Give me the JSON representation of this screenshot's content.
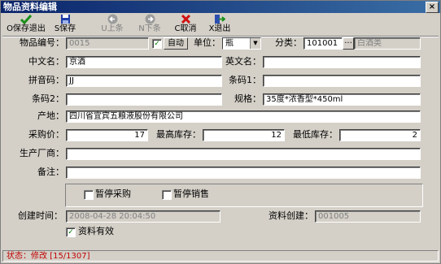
{
  "window": {
    "title": "物品资料编辑",
    "close_glyph": "×"
  },
  "toolbar": {
    "save_exit": "O保存退出",
    "save": "S保存",
    "prev": "U上条",
    "next": "N下条",
    "cancel": "C取消",
    "exit": "X退出"
  },
  "form": {
    "item_code_label": "物品编号：",
    "item_code_value": "0015",
    "auto_label": "自动",
    "unit_label": "单位：",
    "unit_value": "瓶",
    "category_label": "分类：",
    "category_code": "101001",
    "category_more": "···",
    "category_name": "白酒类",
    "cn_name_label": "中文名：",
    "cn_name_value": "京酒",
    "en_name_label": "英文名：",
    "en_name_value": "",
    "pinyin_label": "拼音码：",
    "pinyin_value": "JJ",
    "barcode1_label": "条码1：",
    "barcode1_value": "",
    "barcode2_label": "条码2：",
    "barcode2_value": "",
    "spec_label": "规格：",
    "spec_value": "35度*浓香型*450ml",
    "origin_label": "产地：",
    "origin_value": "四川省宜宾五粮液股份有限公司",
    "purchase_price_label": "采购价：",
    "purchase_price_value": "17",
    "max_stock_label": "最高库存：",
    "max_stock_value": "12",
    "min_stock_label": "最低库存：",
    "min_stock_value": "2",
    "manufacturer_label": "生产厂商：",
    "manufacturer_value": "",
    "remark_label": "备注：",
    "remark_value": "",
    "stop_purchase_label": "暂停采购",
    "stop_sales_label": "暂停销售",
    "created_time_label": "创建时间：",
    "created_time_value": "2008-04-28 20:04:50",
    "created_by_label": "资料创建：",
    "created_by_value": "001005",
    "valid_label": "资料有效",
    "check_mark": "✓"
  },
  "status": {
    "text": "状态：修改 [15/1307]"
  },
  "colors": {
    "status_text": "#c00000",
    "titlebar": "#0a246a",
    "check": "#007a00"
  }
}
